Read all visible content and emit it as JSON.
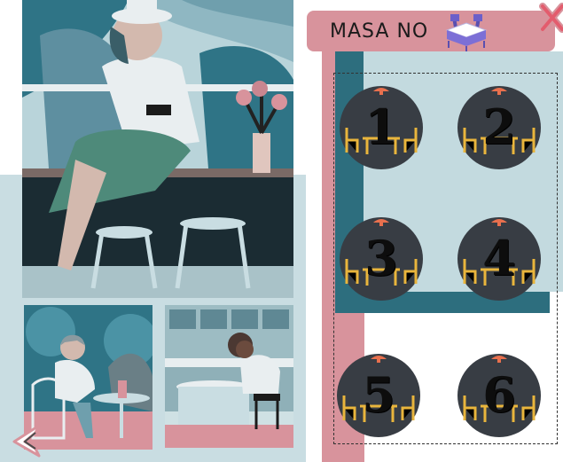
{
  "header": {
    "title": "MASA NO"
  },
  "icons": {
    "header_icon": "dining-table-icon",
    "close": "close-icon",
    "back": "back-arrow-icon"
  },
  "tables": [
    {
      "number": "1"
    },
    {
      "number": "2"
    },
    {
      "number": "3"
    },
    {
      "number": "4"
    },
    {
      "number": "5"
    },
    {
      "number": "6"
    }
  ],
  "colors": {
    "accent_pink": "#d8939c",
    "teal": "#2d6e7e",
    "table_circle": "#383d44",
    "lamp": "#e8704e",
    "chair": "#e9b53c"
  }
}
